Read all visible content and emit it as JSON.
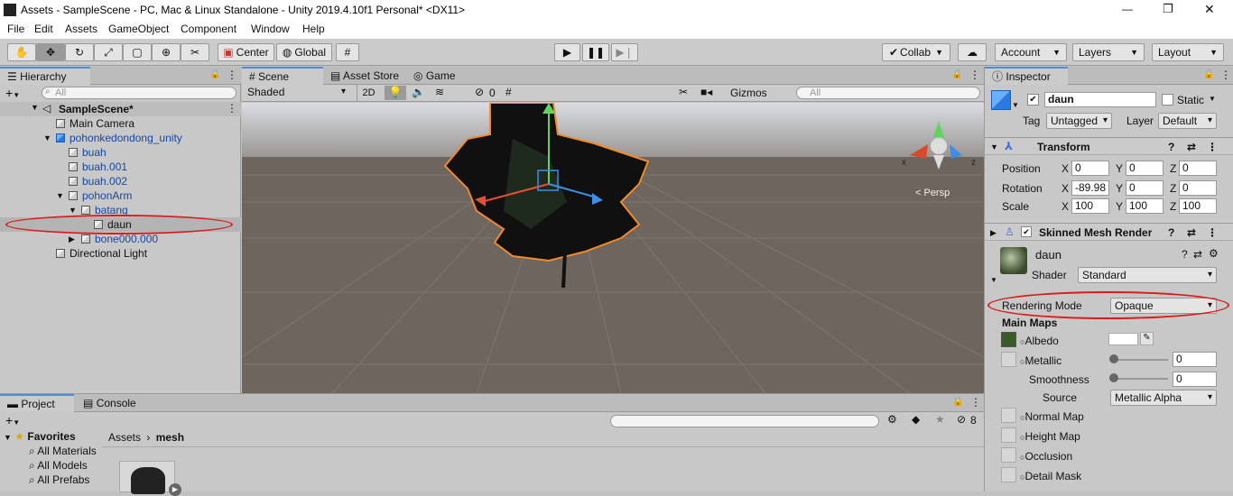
{
  "window": {
    "title": "Assets - SampleScene - PC, Mac & Linux Standalone - Unity 2019.4.10f1 Personal* <DX11>",
    "minimize": "—",
    "maximize": "❐",
    "close": "✕"
  },
  "menu": [
    "File",
    "Edit",
    "Assets",
    "GameObject",
    "Component",
    "Window",
    "Help"
  ],
  "toolbar": {
    "pivot_label": "Center",
    "space_label": "Global",
    "collab_label": "Collab",
    "account_label": "Account",
    "layers_label": "Layers",
    "layout_label": "Layout"
  },
  "hierarchy": {
    "tab": "Hierarchy",
    "search_placeholder": "All",
    "add": "+",
    "scene_name": "SampleScene*",
    "items": [
      {
        "label": "Main Camera"
      },
      {
        "label": "pohonkedondong_unity"
      },
      {
        "label": "buah"
      },
      {
        "label": "buah.001"
      },
      {
        "label": "buah.002"
      },
      {
        "label": "pohonArm"
      },
      {
        "label": "batang"
      },
      {
        "label": "daun"
      },
      {
        "label": "bone000.000"
      },
      {
        "label": "Directional Light"
      }
    ]
  },
  "scene": {
    "tabs": [
      "Scene",
      "Asset Store",
      "Game"
    ],
    "shading_mode": "Shaded",
    "mode_2d": "2D",
    "hidden_count": "0",
    "gizmos_label": "Gizmos",
    "search_placeholder": "All",
    "persp_label": "< Persp",
    "gizmo_x": "x",
    "gizmo_z": "z"
  },
  "project": {
    "tabs": [
      "Project",
      "Console"
    ],
    "add": "+",
    "favorites_label": "Favorites",
    "favorites": [
      "All Materials",
      "All Models",
      "All Prefabs"
    ],
    "breadcrumb": [
      "Assets",
      "mesh"
    ],
    "hidden_count": "8"
  },
  "inspector": {
    "tab": "Inspector",
    "object_name": "daun",
    "static_label": "Static",
    "tag_label": "Tag",
    "tag_value": "Untagged",
    "layer_label": "Layer",
    "layer_value": "Default",
    "transform": {
      "title": "Transform",
      "position_label": "Position",
      "rotation_label": "Rotation",
      "scale_label": "Scale",
      "position": {
        "x": "0",
        "y": "0",
        "z": "0"
      },
      "rotation": {
        "x": "-89.98",
        "y": "0",
        "z": "0"
      },
      "scale": {
        "x": "100",
        "y": "100",
        "z": "100"
      }
    },
    "skinned_mesh_title": "Skinned Mesh Renderer",
    "material": {
      "name": "daun",
      "shader_label": "Shader",
      "shader_value": "Standard",
      "rendering_mode_label": "Rendering Mode",
      "rendering_mode_value": "Opaque",
      "main_maps_label": "Main Maps",
      "albedo_label": "Albedo",
      "metallic_label": "Metallic",
      "metallic_value": "0",
      "smoothness_label": "Smoothness",
      "smoothness_value": "0",
      "source_label": "Source",
      "source_value": "Metallic Alpha",
      "normal_map_label": "Normal Map",
      "height_map_label": "Height Map",
      "occlusion_label": "Occlusion",
      "detail_mask_label": "Detail Mask"
    }
  },
  "colors": {
    "accent": "#4a90d9",
    "selection": "#d81c1c",
    "outline": "#f28a2c"
  }
}
